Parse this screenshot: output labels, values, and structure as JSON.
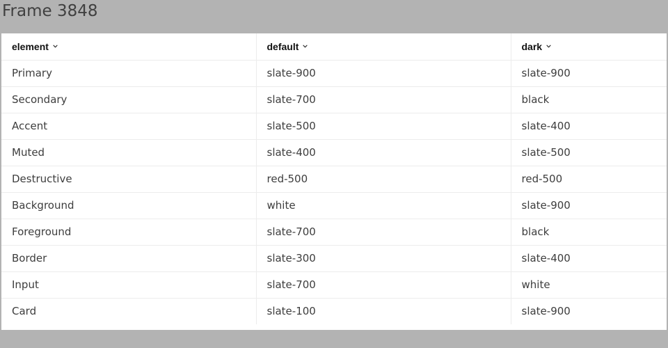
{
  "frame": {
    "title": "Frame 3848"
  },
  "table": {
    "columns": [
      {
        "label": "element",
        "icon": "chevron-down-icon"
      },
      {
        "label": "default",
        "icon": "chevron-down-icon"
      },
      {
        "label": "dark",
        "icon": "chevron-down-icon"
      }
    ],
    "rows": [
      [
        "Primary",
        "slate-900",
        "slate-900"
      ],
      [
        "Secondary",
        "slate-700",
        "black"
      ],
      [
        "Accent",
        "slate-500",
        "slate-400"
      ],
      [
        "Muted",
        "slate-400",
        "slate-500"
      ],
      [
        "Destructive",
        "red-500",
        "red-500"
      ],
      [
        "Background",
        "white",
        "slate-900"
      ],
      [
        "Foreground",
        "slate-700",
        "black"
      ],
      [
        "Border",
        "slate-300",
        "slate-400"
      ],
      [
        "Input",
        "slate-700",
        "white"
      ],
      [
        "Card",
        "slate-100",
        "slate-900"
      ]
    ]
  },
  "colors": {
    "frame_background": "#b3b3b3",
    "table_background": "#ffffff",
    "cell_border": "#ececec",
    "header_text": "#111111",
    "cell_text": "#3d3d3d"
  }
}
